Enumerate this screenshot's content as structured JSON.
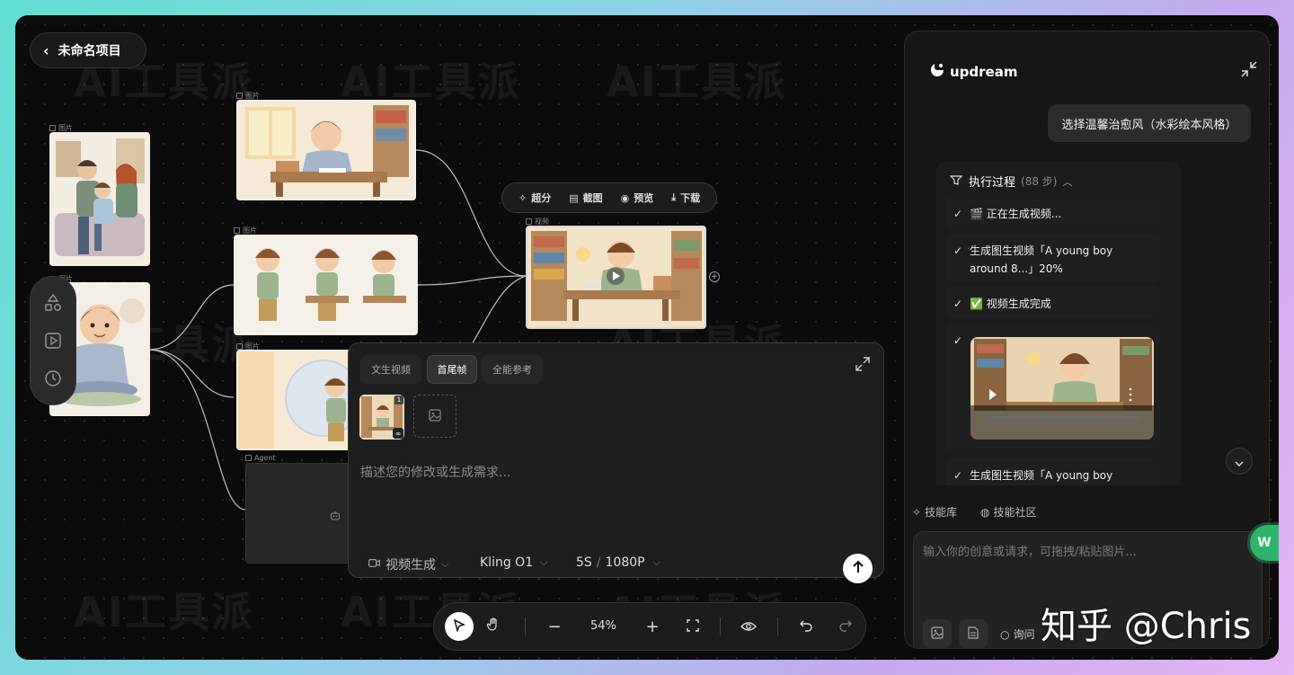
{
  "project": {
    "title": "未命名项目"
  },
  "watermark": "AI工具派",
  "nodes": {
    "image_label": "图片",
    "video_label": "视频",
    "agent_label": "Agent"
  },
  "node_toolbar": {
    "upscale": "超分",
    "screenshot": "截图",
    "preview": "预览",
    "download": "下载"
  },
  "composer": {
    "tabs": [
      "文生视频",
      "首尾帧",
      "全能参考"
    ],
    "active_tab": "首尾帧",
    "thumb_badge": "1",
    "placeholder": "描述您的修改或生成需求...",
    "mode": "视频生成",
    "model": "Kling O1",
    "spec": "5S",
    "spec_sep": "/",
    "resolution": "1080P"
  },
  "bottom_toolbar": {
    "zoom": "54%"
  },
  "chat": {
    "brand": "updream",
    "user_message": "选择温馨治愈风（水彩绘本风格）",
    "process_title": "执行过程",
    "process_count": "(88 步)",
    "steps": [
      "🎬 正在生成视频...",
      "生成图生视频「A young boy around 8...」20%",
      "✅ 视频生成完成",
      "生成图生视频「A young boy around"
    ],
    "skills": "技能库",
    "community": "技能社区",
    "input_placeholder": "输入你的创意或请求，可拖拽/粘贴图片...",
    "ask_label": "询问"
  },
  "overlay_credit": "知乎 @Chris",
  "colors": {
    "accent_green": "#2db36a",
    "bg": "#0b0b0b",
    "panel": "#1e1e1e"
  }
}
